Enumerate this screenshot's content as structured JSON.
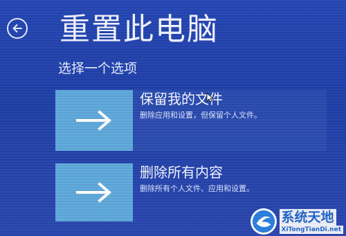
{
  "header": {
    "back_icon": "back-arrow-icon",
    "title": "重置此电脑"
  },
  "subtitle": "选择一个选项",
  "options": [
    {
      "icon": "arrow-right-icon",
      "heading": "保留我的文件",
      "description": "删除应用和设置，但保留个人文件。"
    },
    {
      "icon": "arrow-right-icon",
      "heading": "删除所有内容",
      "description": "删除所有个人文件、应用和设置。"
    }
  ],
  "watermark": {
    "name": "系统天地",
    "url": "XiTongTianDi.net"
  },
  "colors": {
    "background": "#1f3ea6",
    "tile": "#5fa9dc",
    "text": "#ffffff",
    "watermark": "#1f63c8"
  }
}
